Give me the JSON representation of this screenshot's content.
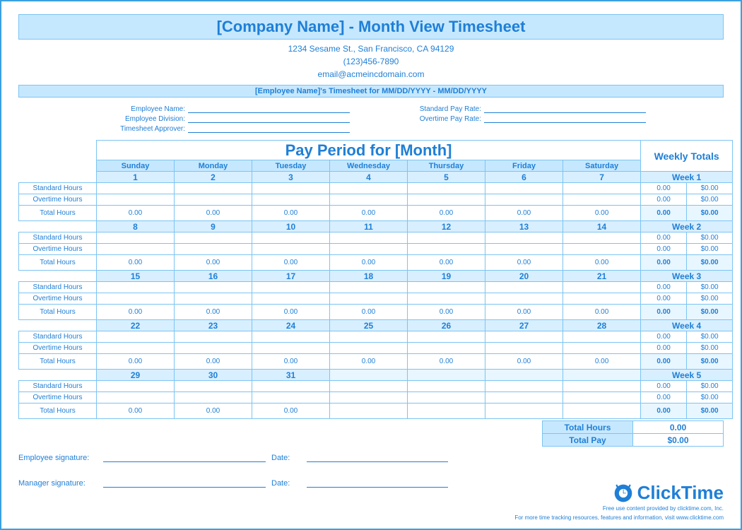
{
  "header": {
    "title": "[Company Name] - Month View Timesheet",
    "address": "1234 Sesame St.,  San Francisco, CA 94129",
    "phone": "(123)456-7890",
    "email": "email@acmeincdomain.com",
    "subtitle": "[Employee Name]'s Timesheet for MM/DD/YYYY - MM/DD/YYYY"
  },
  "emp": {
    "name_label": "Employee Name:",
    "division_label": "Employee Division:",
    "approver_label": "Timesheet Approver:",
    "std_rate_label": "Standard Pay Rate:",
    "ot_rate_label": "Overtime Pay Rate:"
  },
  "grid": {
    "pay_period_title": "Pay Period for [Month]",
    "weekly_totals_title": "Weekly Totals",
    "days": [
      "Sunday",
      "Monday",
      "Tuesday",
      "Wednesday",
      "Thursday",
      "Friday",
      "Saturday"
    ],
    "row_labels": {
      "std": "Standard Hours",
      "ot": "Overtime Hours",
      "tot": "Total Hours"
    },
    "weeks": [
      {
        "name": "Week 1",
        "dates": [
          "1",
          "2",
          "3",
          "4",
          "5",
          "6",
          "7"
        ],
        "active": 7,
        "std_h": "0.00",
        "std_p": "$0.00",
        "ot_h": "0.00",
        "ot_p": "$0.00",
        "tot_h": "0.00",
        "tot_p": "$0.00",
        "day_tot": [
          "0.00",
          "0.00",
          "0.00",
          "0.00",
          "0.00",
          "0.00",
          "0.00"
        ]
      },
      {
        "name": "Week 2",
        "dates": [
          "8",
          "9",
          "10",
          "11",
          "12",
          "13",
          "14"
        ],
        "active": 7,
        "std_h": "0.00",
        "std_p": "$0.00",
        "ot_h": "0.00",
        "ot_p": "$0.00",
        "tot_h": "0.00",
        "tot_p": "$0.00",
        "day_tot": [
          "0.00",
          "0.00",
          "0.00",
          "0.00",
          "0.00",
          "0.00",
          "0.00"
        ]
      },
      {
        "name": "Week 3",
        "dates": [
          "15",
          "16",
          "17",
          "18",
          "19",
          "20",
          "21"
        ],
        "active": 7,
        "std_h": "0.00",
        "std_p": "$0.00",
        "ot_h": "0.00",
        "ot_p": "$0.00",
        "tot_h": "0.00",
        "tot_p": "$0.00",
        "day_tot": [
          "0.00",
          "0.00",
          "0.00",
          "0.00",
          "0.00",
          "0.00",
          "0.00"
        ]
      },
      {
        "name": "Week 4",
        "dates": [
          "22",
          "23",
          "24",
          "25",
          "26",
          "27",
          "28"
        ],
        "active": 7,
        "std_h": "0.00",
        "std_p": "$0.00",
        "ot_h": "0.00",
        "ot_p": "$0.00",
        "tot_h": "0.00",
        "tot_p": "$0.00",
        "day_tot": [
          "0.00",
          "0.00",
          "0.00",
          "0.00",
          "0.00",
          "0.00",
          "0.00"
        ]
      },
      {
        "name": "Week 5",
        "dates": [
          "29",
          "30",
          "31",
          "",
          "",
          "",
          ""
        ],
        "active": 3,
        "std_h": "0.00",
        "std_p": "$0.00",
        "ot_h": "0.00",
        "ot_p": "$0.00",
        "tot_h": "0.00",
        "tot_p": "$0.00",
        "day_tot": [
          "0.00",
          "0.00",
          "0.00",
          "",
          "",
          "",
          ""
        ]
      }
    ]
  },
  "totals": {
    "hours_label": "Total Hours",
    "pay_label": "Total Pay",
    "hours_value": "0.00",
    "pay_value": "$0.00"
  },
  "sign": {
    "emp": "Employee signature:",
    "mgr": "Manager signature:",
    "date": "Date:"
  },
  "footer": {
    "brand": "ClickTime",
    "line1": "Free use content provided by clicktime.com, Inc.",
    "line2": "For more time tracking resources, features and information, visit www.clicktime.com"
  }
}
